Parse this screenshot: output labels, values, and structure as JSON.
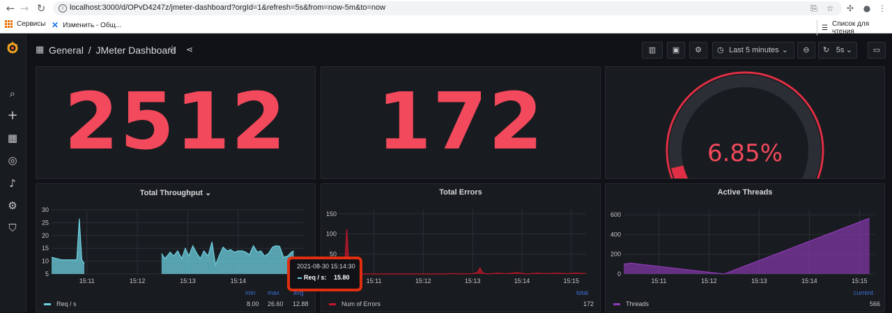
{
  "browser": {
    "url": "localhost:3000/d/OPvD4247z/jmeter-dashboard?orgId=1&refresh=5s&from=now-5m&to=now",
    "bookmarks": [
      "Сервисы",
      "Изменить - Общ..."
    ],
    "reading_list": "Список для чтения"
  },
  "header": {
    "breadcrumb_root": "General",
    "dashboard_title": "JMeter Dashboard",
    "time_range": "Last 5 minutes",
    "refresh_interval": "5s"
  },
  "stats": {
    "total_requests": "2512",
    "total_errors": "172",
    "error_rate": "6.85%",
    "error_rate_value": 0.0685
  },
  "colors": {
    "accent_red": "#f2495c",
    "throughput": "#6ed0e0",
    "errors": "#c4162a",
    "threads": "#8f3bb8"
  },
  "panels": {
    "throughput": {
      "title": "Total Throughput",
      "legend": "Req / s",
      "headers": [
        "min",
        "max",
        "avg"
      ],
      "values": [
        "8.00",
        "26.60",
        "12.88"
      ]
    },
    "errors": {
      "title": "Total Errors",
      "legend": "Num of Errors",
      "header": "total",
      "value": "172"
    },
    "threads": {
      "title": "Active Threads",
      "legend": "Threads",
      "header": "current",
      "value": "566"
    }
  },
  "tooltip": {
    "time": "2021-08-30 15:14:30",
    "series": "Req / s:",
    "value": "15.80"
  },
  "chart_data": [
    {
      "type": "area",
      "title": "Total Throughput",
      "yticks": [
        "30",
        "25",
        "20",
        "15",
        "10",
        "5"
      ],
      "xticks": [
        "15:11",
        "15:12",
        "15:13",
        "15:14"
      ],
      "ylim": [
        5,
        30
      ],
      "xlim": [
        10.2,
        15.2
      ],
      "series": [
        {
          "name": "Req / s",
          "x": [
            10.2,
            10.4,
            10.55,
            10.6,
            10.7,
            10.75,
            10.8,
            10.85,
            12.38,
            12.45,
            12.55,
            12.62,
            12.7,
            12.78,
            12.85,
            12.92,
            13.0,
            13.08,
            13.15,
            13.22,
            13.3,
            13.38,
            13.45,
            13.52,
            13.6,
            13.68,
            13.75,
            13.82,
            13.9,
            13.98,
            14.05,
            14.12,
            14.2,
            14.28,
            14.35,
            14.42,
            14.5,
            14.58,
            14.65,
            14.72,
            14.8,
            14.88,
            14.95,
            15.0
          ],
          "values": [
            11.5,
            10.5,
            10.5,
            10.5,
            10.5,
            26.6,
            10.5,
            9,
            13,
            11,
            13.5,
            12,
            14,
            11,
            15,
            12,
            16,
            13,
            11,
            14,
            12,
            17.5,
            8.5,
            12,
            15.5,
            14,
            14.5,
            13.5,
            14,
            14,
            13.5,
            12.5,
            16,
            13.5,
            14,
            12,
            13,
            15.5,
            16,
            15.8,
            11.5,
            12,
            13.5,
            14
          ]
        }
      ]
    },
    {
      "type": "area",
      "title": "Total Errors",
      "yticks": [
        "150",
        "100",
        "50"
      ],
      "xticks": [
        "15:11",
        "15:12",
        "15:13",
        "15:14",
        "15:15"
      ],
      "ylim": [
        0,
        160
      ],
      "xlim": [
        10.3,
        15.3
      ],
      "series": [
        {
          "name": "Num of Errors",
          "x": [
            10.3,
            10.4,
            10.45,
            10.5,
            10.55,
            10.62,
            12.4,
            12.6,
            12.8,
            13.0,
            13.1,
            13.15,
            13.2,
            13.3,
            13.5,
            13.7,
            13.9,
            14.1,
            14.3,
            14.5,
            14.7,
            14.9,
            15.1,
            15.3
          ],
          "values": [
            0,
            0,
            112,
            8,
            0,
            0,
            0,
            1,
            0,
            1,
            4,
            15,
            3,
            0,
            2,
            1,
            3,
            0,
            2,
            1,
            2,
            1,
            2,
            1
          ]
        }
      ]
    },
    {
      "type": "area",
      "title": "Active Threads",
      "yticks": [
        "600",
        "400",
        "200",
        "0"
      ],
      "xticks": [
        "15:11",
        "15:12",
        "15:13",
        "15:14",
        "15:15"
      ],
      "ylim": [
        0,
        650
      ],
      "xlim": [
        10.3,
        15.3
      ],
      "series": [
        {
          "name": "Threads",
          "x": [
            10.3,
            10.45,
            10.6,
            12.3,
            15.2
          ],
          "values": [
            100,
            110,
            100,
            0,
            566
          ]
        }
      ]
    }
  ]
}
